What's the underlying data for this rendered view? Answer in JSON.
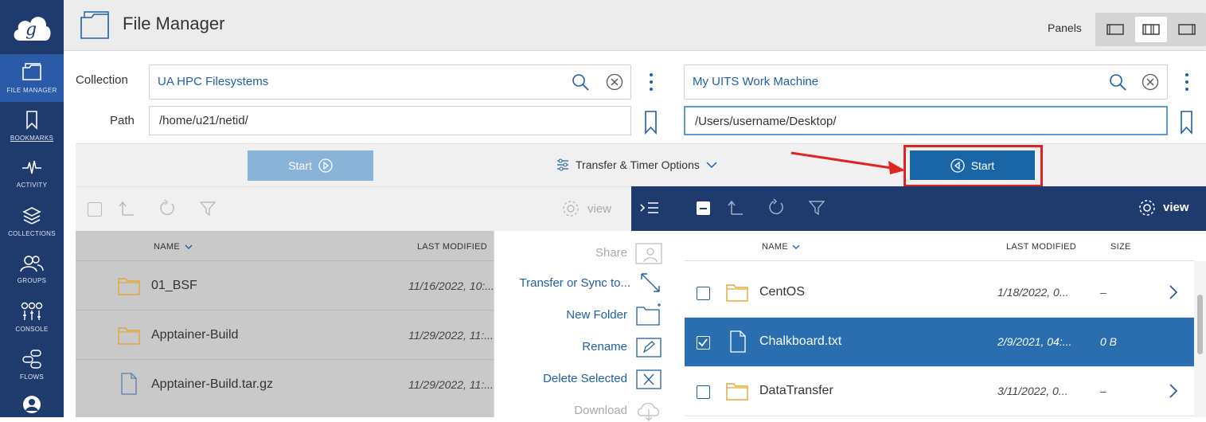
{
  "sidebar": {
    "items": [
      {
        "label": "FILE MANAGER",
        "icon": "file-manager-icon"
      },
      {
        "label": "BOOKMARKS",
        "icon": "bookmark-icon"
      },
      {
        "label": "ACTIVITY",
        "icon": "activity-icon"
      },
      {
        "label": "COLLECTIONS",
        "icon": "collections-icon"
      },
      {
        "label": "GROUPS",
        "icon": "groups-icon"
      },
      {
        "label": "CONSOLE",
        "icon": "console-icon"
      },
      {
        "label": "FLOWS",
        "icon": "flows-icon"
      },
      {
        "label": "",
        "icon": "account-icon"
      }
    ]
  },
  "header": {
    "title": "File Manager",
    "panels_label": "Panels"
  },
  "left": {
    "collection_label": "Collection",
    "collection": "UA HPC Filesystems",
    "path_label": "Path",
    "path": "/home/u21/netid/",
    "start_label": "Start",
    "view_label": "view",
    "columns": {
      "name": "NAME",
      "modified": "LAST MODIFIED"
    },
    "rows": [
      {
        "name": "01_BSF",
        "modified": "11/16/2022, 10:...",
        "type": "folder"
      },
      {
        "name": "Apptainer-Build",
        "modified": "11/29/2022, 11:...",
        "type": "folder"
      },
      {
        "name": "Apptainer-Build.tar.gz",
        "modified": "11/29/2022, 11:...",
        "type": "file"
      }
    ]
  },
  "transfer_options": "Transfer & Timer Options",
  "menu": {
    "share": "Share",
    "transfer": "Transfer or Sync to...",
    "new_folder": "New Folder",
    "rename": "Rename",
    "delete": "Delete Selected",
    "download": "Download"
  },
  "right": {
    "collection": "My UITS Work Machine",
    "path": "/Users/username/Desktop/",
    "start_label": "Start",
    "view_label": "view",
    "columns": {
      "name": "NAME",
      "modified": "LAST MODIFIED",
      "size": "SIZE"
    },
    "rows": [
      {
        "name": "CentOS",
        "modified": "1/18/2022, 0...",
        "size": "–",
        "type": "folder",
        "selected": false
      },
      {
        "name": "Chalkboard.txt",
        "modified": "2/9/2021, 04:...",
        "size": "0 B",
        "type": "file",
        "selected": true
      },
      {
        "name": "DataTransfer",
        "modified": "3/11/2022, 0...",
        "size": "–",
        "type": "folder",
        "selected": false
      }
    ]
  },
  "colors": {
    "navy": "#1f3b6e",
    "primary": "#1a65a6",
    "selected_row": "#2a6eaf",
    "highlight": "#e02424"
  }
}
